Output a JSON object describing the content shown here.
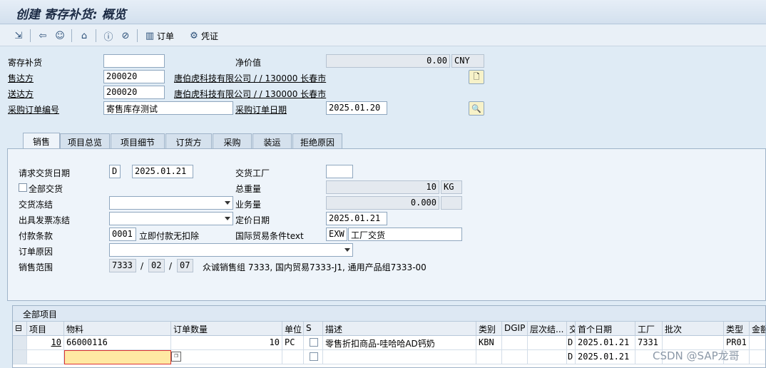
{
  "window": {
    "title": "创建 寄存补货: 概览"
  },
  "toolbar": {
    "icons": [
      "save-icon",
      "back-icon",
      "user-icon",
      "home-icon",
      "info-icon",
      "cancel-icon",
      "orders-icon",
      "document-icon"
    ],
    "order_label": "订单",
    "voucher_label": "凭证"
  },
  "header": {
    "consign_label": "寄存补货",
    "consign_value": "",
    "net_label": "净价值",
    "net_value": "0.00",
    "currency": "CNY",
    "soldto_label": "售达方",
    "soldto_value": "200020",
    "soldto_name": "唐伯虎科技有限公司 / / 130000 长春市",
    "shipto_label": "送达方",
    "shipto_value": "200020",
    "shipto_name": "唐伯虎科技有限公司 / / 130000 长春市",
    "po_label": "采购订单编号",
    "po_value": "寄售库存测试",
    "podate_label": "采购订单日期",
    "podate_value": "2025.01.20"
  },
  "tabs": [
    "销售",
    "项目总览",
    "项目细节",
    "订货方",
    "采购",
    "装运",
    "拒绝原因"
  ],
  "sales": {
    "req_date_label": "请求交货日期",
    "req_date_type": "D",
    "req_date_value": "2025.01.21",
    "plant_label": "交货工厂",
    "plant_value": "",
    "complete_label": "全部交货",
    "weight_label": "总重量",
    "weight_value": "10",
    "weight_unit": "KG",
    "block_label": "交货冻结",
    "block_value": "",
    "volume_label": "业务量",
    "volume_value": "0.000",
    "volume_unit": "",
    "billing_label": "出具发票冻结",
    "billing_value": "",
    "pricing_label": "定价日期",
    "pricing_value": "2025.01.21",
    "payment_label": "付款条款",
    "payment_value": "0001",
    "payment_text": "立即付款无扣除",
    "incoterm_label": "国际贸易条件text",
    "incoterm_value": "EXW",
    "incoterm_text": "工厂交货",
    "reason_label": "订单原因",
    "reason_value": "",
    "area_label": "销售范围",
    "area_org": "7333",
    "area_ch": "02",
    "area_div": "07",
    "area_slash1": "/",
    "area_slash2": "/",
    "area_text": "众诚销售组 7333, 国内贸易7333-J1, 通用产品组7333-00"
  },
  "items": {
    "title": "全部项目",
    "columns": [
      "项目",
      "物料",
      "订单数量",
      "单位",
      "S",
      "描述",
      "类别",
      "DGIP",
      "层次结...",
      "交",
      "首个日期",
      "工厂",
      "批次",
      "类型",
      "金额"
    ],
    "rows": [
      {
        "item": "10",
        "material": "66000116",
        "qty": "10",
        "unit": "PC",
        "desc": "零售折扣商品-哇哈哈AD钙奶",
        "cat": "KBN",
        "dgip": "",
        "hier": "",
        "del": "D",
        "date": "2025.01.21",
        "plant": "7331",
        "batch": "",
        "type": "PR01"
      },
      {
        "item": "",
        "material": "",
        "qty": "",
        "unit": "",
        "desc": "",
        "cat": "",
        "dgip": "",
        "hier": "",
        "del": "D",
        "date": "2025.01.21",
        "plant": "",
        "batch": "",
        "type": ""
      }
    ]
  },
  "watermark": "CSDN @SAP龙哥"
}
